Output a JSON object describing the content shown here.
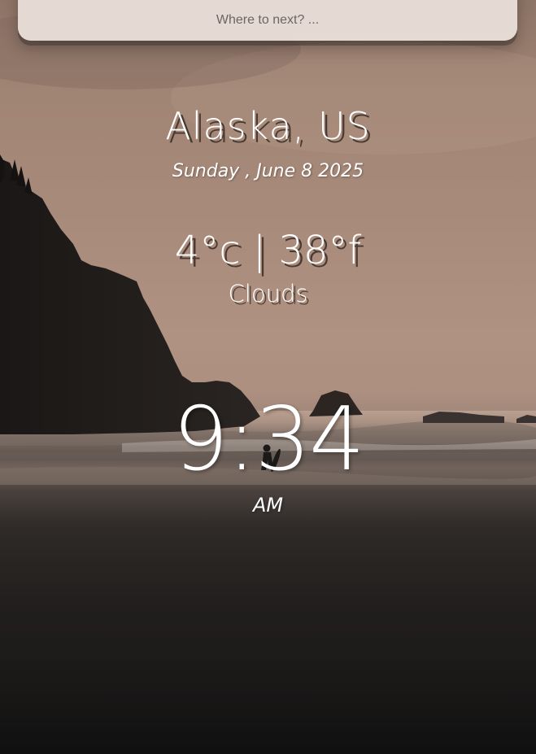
{
  "search": {
    "placeholder": "Where to next? ..."
  },
  "weather": {
    "location": "Alaska, US",
    "date": "Sunday , June 8 2025",
    "temperature": "4°c | 38°f",
    "condition": "Clouds"
  },
  "clock": {
    "time": "9:34",
    "period": "AM"
  }
}
